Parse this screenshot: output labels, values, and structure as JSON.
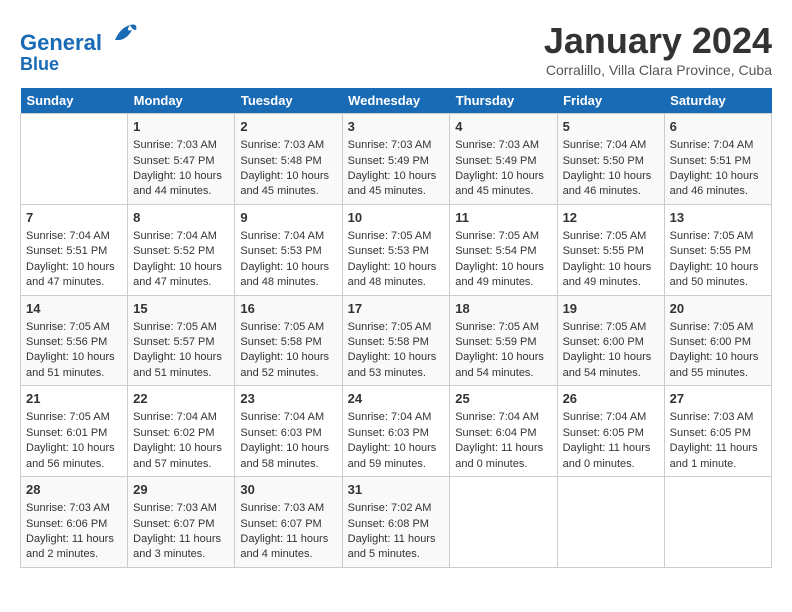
{
  "header": {
    "logo_line1": "General",
    "logo_line2": "Blue",
    "month": "January 2024",
    "location": "Corralillo, Villa Clara Province, Cuba"
  },
  "days_of_week": [
    "Sunday",
    "Monday",
    "Tuesday",
    "Wednesday",
    "Thursday",
    "Friday",
    "Saturday"
  ],
  "weeks": [
    [
      {
        "day": "",
        "content": ""
      },
      {
        "day": "1",
        "content": "Sunrise: 7:03 AM\nSunset: 5:47 PM\nDaylight: 10 hours\nand 44 minutes."
      },
      {
        "day": "2",
        "content": "Sunrise: 7:03 AM\nSunset: 5:48 PM\nDaylight: 10 hours\nand 45 minutes."
      },
      {
        "day": "3",
        "content": "Sunrise: 7:03 AM\nSunset: 5:49 PM\nDaylight: 10 hours\nand 45 minutes."
      },
      {
        "day": "4",
        "content": "Sunrise: 7:03 AM\nSunset: 5:49 PM\nDaylight: 10 hours\nand 45 minutes."
      },
      {
        "day": "5",
        "content": "Sunrise: 7:04 AM\nSunset: 5:50 PM\nDaylight: 10 hours\nand 46 minutes."
      },
      {
        "day": "6",
        "content": "Sunrise: 7:04 AM\nSunset: 5:51 PM\nDaylight: 10 hours\nand 46 minutes."
      }
    ],
    [
      {
        "day": "7",
        "content": "Sunrise: 7:04 AM\nSunset: 5:51 PM\nDaylight: 10 hours\nand 47 minutes."
      },
      {
        "day": "8",
        "content": "Sunrise: 7:04 AM\nSunset: 5:52 PM\nDaylight: 10 hours\nand 47 minutes."
      },
      {
        "day": "9",
        "content": "Sunrise: 7:04 AM\nSunset: 5:53 PM\nDaylight: 10 hours\nand 48 minutes."
      },
      {
        "day": "10",
        "content": "Sunrise: 7:05 AM\nSunset: 5:53 PM\nDaylight: 10 hours\nand 48 minutes."
      },
      {
        "day": "11",
        "content": "Sunrise: 7:05 AM\nSunset: 5:54 PM\nDaylight: 10 hours\nand 49 minutes."
      },
      {
        "day": "12",
        "content": "Sunrise: 7:05 AM\nSunset: 5:55 PM\nDaylight: 10 hours\nand 49 minutes."
      },
      {
        "day": "13",
        "content": "Sunrise: 7:05 AM\nSunset: 5:55 PM\nDaylight: 10 hours\nand 50 minutes."
      }
    ],
    [
      {
        "day": "14",
        "content": "Sunrise: 7:05 AM\nSunset: 5:56 PM\nDaylight: 10 hours\nand 51 minutes."
      },
      {
        "day": "15",
        "content": "Sunrise: 7:05 AM\nSunset: 5:57 PM\nDaylight: 10 hours\nand 51 minutes."
      },
      {
        "day": "16",
        "content": "Sunrise: 7:05 AM\nSunset: 5:58 PM\nDaylight: 10 hours\nand 52 minutes."
      },
      {
        "day": "17",
        "content": "Sunrise: 7:05 AM\nSunset: 5:58 PM\nDaylight: 10 hours\nand 53 minutes."
      },
      {
        "day": "18",
        "content": "Sunrise: 7:05 AM\nSunset: 5:59 PM\nDaylight: 10 hours\nand 54 minutes."
      },
      {
        "day": "19",
        "content": "Sunrise: 7:05 AM\nSunset: 6:00 PM\nDaylight: 10 hours\nand 54 minutes."
      },
      {
        "day": "20",
        "content": "Sunrise: 7:05 AM\nSunset: 6:00 PM\nDaylight: 10 hours\nand 55 minutes."
      }
    ],
    [
      {
        "day": "21",
        "content": "Sunrise: 7:05 AM\nSunset: 6:01 PM\nDaylight: 10 hours\nand 56 minutes."
      },
      {
        "day": "22",
        "content": "Sunrise: 7:04 AM\nSunset: 6:02 PM\nDaylight: 10 hours\nand 57 minutes."
      },
      {
        "day": "23",
        "content": "Sunrise: 7:04 AM\nSunset: 6:03 PM\nDaylight: 10 hours\nand 58 minutes."
      },
      {
        "day": "24",
        "content": "Sunrise: 7:04 AM\nSunset: 6:03 PM\nDaylight: 10 hours\nand 59 minutes."
      },
      {
        "day": "25",
        "content": "Sunrise: 7:04 AM\nSunset: 6:04 PM\nDaylight: 11 hours\nand 0 minutes."
      },
      {
        "day": "26",
        "content": "Sunrise: 7:04 AM\nSunset: 6:05 PM\nDaylight: 11 hours\nand 0 minutes."
      },
      {
        "day": "27",
        "content": "Sunrise: 7:03 AM\nSunset: 6:05 PM\nDaylight: 11 hours\nand 1 minute."
      }
    ],
    [
      {
        "day": "28",
        "content": "Sunrise: 7:03 AM\nSunset: 6:06 PM\nDaylight: 11 hours\nand 2 minutes."
      },
      {
        "day": "29",
        "content": "Sunrise: 7:03 AM\nSunset: 6:07 PM\nDaylight: 11 hours\nand 3 minutes."
      },
      {
        "day": "30",
        "content": "Sunrise: 7:03 AM\nSunset: 6:07 PM\nDaylight: 11 hours\nand 4 minutes."
      },
      {
        "day": "31",
        "content": "Sunrise: 7:02 AM\nSunset: 6:08 PM\nDaylight: 11 hours\nand 5 minutes."
      },
      {
        "day": "",
        "content": ""
      },
      {
        "day": "",
        "content": ""
      },
      {
        "day": "",
        "content": ""
      }
    ]
  ]
}
